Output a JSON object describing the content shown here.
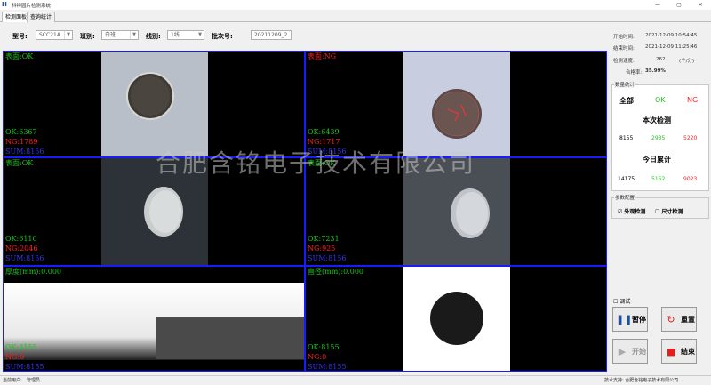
{
  "window": {
    "title": "科特圆片检测系统",
    "icon": "H"
  },
  "tabs": [
    {
      "label": "检测面板"
    },
    {
      "label": "查询统计"
    }
  ],
  "params": {
    "model_label": "型号:",
    "model_value": "SCC21A",
    "shift_label": "班别:",
    "shift_value": "白班",
    "line_label": "线别:",
    "line_value": "1线",
    "batch_label": "批次号:",
    "batch_value": "20211209_2"
  },
  "cells": [
    {
      "title": "表面:OK",
      "title_color": "g",
      "ok": "OK:6367",
      "ng": "NG:1789",
      "sum": "SUM:8156"
    },
    {
      "title": "表面:NG",
      "title_color": "r",
      "ok": "OK:6439",
      "ng": "NG:1717",
      "sum": "SUM:8156"
    },
    {
      "title": "表面:OK",
      "title_color": "g",
      "ok": "OK:6110",
      "ng": "NG:2046",
      "sum": "SUM:8156"
    },
    {
      "title": "表面:OK",
      "title_color": "g",
      "ok": "OK:7231",
      "ng": "NG:925",
      "sum": "SUM:8156"
    },
    {
      "title": "厚度(mm):0.000",
      "title_color": "g",
      "ok": "OK:8155",
      "ng": "NG:0",
      "sum": "SUM:8155"
    },
    {
      "title": "直径(mm):0.000",
      "title_color": "g",
      "ok": "OK:8155",
      "ng": "NG:0",
      "sum": "SUM:8155"
    }
  ],
  "watermark": "合肥含铭电子技术有限公司",
  "info": {
    "start_label": "开始时间:",
    "start_value": "2021-12-09 10:54:45",
    "end_label": "结束时间:",
    "end_value": "2021-12-09 11:25:46",
    "speed_label": "检测速度:",
    "speed_value": "262",
    "speed_unit": "(个/分)",
    "rate_label": "合格率:",
    "rate_value": "35.99%"
  },
  "stats": {
    "group_title": "数量统计",
    "col_all": "全部",
    "col_ok": "OK",
    "col_ng": "NG",
    "current_title": "本次检测",
    "current_all": "8155",
    "current_ok": "2935",
    "current_ng": "5220",
    "today_title": "今日累计",
    "today_all": "14175",
    "today_ok": "5152",
    "today_ng": "9023"
  },
  "config": {
    "group_title": "参数配置",
    "appearance_label": "外观检测",
    "appearance_checked": true,
    "size_label": "尺寸检测",
    "size_checked": false
  },
  "debug_label": "调试",
  "buttons": {
    "pause": "暂停",
    "reset": "重置",
    "start": "开始",
    "end": "结束"
  },
  "status": {
    "user_label": "当前用户:",
    "user_value": "管理员",
    "support": "技术支持:  合肥含铭电子技术有限公司"
  },
  "colors": {
    "ok": "#19c819",
    "ng": "#ff2020",
    "sum": "#3232ff",
    "frame": "#1a1aff"
  }
}
